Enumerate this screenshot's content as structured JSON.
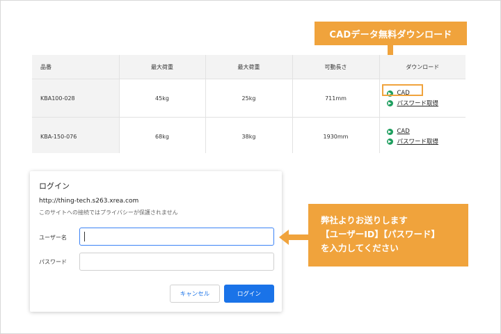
{
  "callouts": {
    "top": "CADデータ無料ダウンロード",
    "side_lines": [
      "弊社よりお送りします",
      "【ユーザーID】【パスワード】",
      "を入力してください"
    ],
    "color": "#f0a33c"
  },
  "table": {
    "headers": [
      "品番",
      "最大荷重",
      "最大荷重",
      "可動長さ",
      "ダウンロード"
    ],
    "rows": [
      {
        "part": "KBA100-028",
        "load1": "45kg",
        "load2": "25kg",
        "length": "711mm",
        "links": [
          "CAD",
          "パスワード取得"
        ]
      },
      {
        "part": "KBA-150-076",
        "load1": "68kg",
        "load2": "38kg",
        "length": "1930mm",
        "links": [
          "CAD",
          "パスワード取得"
        ]
      }
    ],
    "link_icon": "chevron-right-circle-icon",
    "link_icon_color": "#1e9e5e"
  },
  "dialog": {
    "title": "ログイン",
    "url": "http://thing-tech.s263.xrea.com",
    "note": "このサイトへの接続ではプライバシーが保護されません",
    "username_label": "ユーザー名",
    "password_label": "パスワード",
    "username_value": "",
    "password_value": "",
    "cancel_label": "キャンセル",
    "login_label": "ログイン",
    "accent": "#1a73e8"
  }
}
